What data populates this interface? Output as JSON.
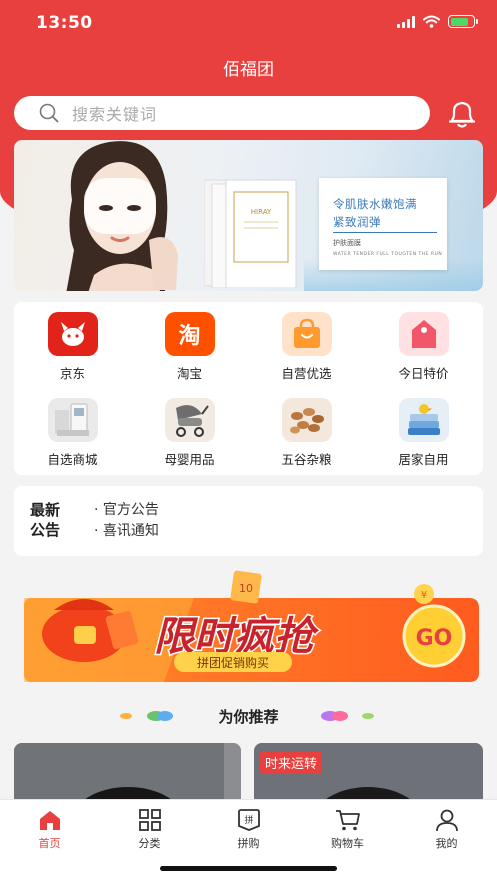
{
  "status_bar": {
    "time": "13:50"
  },
  "app": {
    "title": "佰福团"
  },
  "search": {
    "placeholder": "搜索关键词"
  },
  "banner": {
    "headline_1": "令肌肤水嫩饱满",
    "headline_2": "紧致润弹",
    "product": "护肤面膜",
    "tagline": "WATER  TENDER  FULL  TOUGTEN  THE  RUN",
    "pack_label": "HIRAY"
  },
  "categories": [
    {
      "label": "京东",
      "icon": "jd-icon"
    },
    {
      "label": "淘宝",
      "icon": "taobao-icon",
      "glyph": "淘"
    },
    {
      "label": "自营优选",
      "icon": "shopping-bag-icon"
    },
    {
      "label": "今日特价",
      "icon": "price-tag-icon"
    },
    {
      "label": "自选商城",
      "icon": "mall-icon"
    },
    {
      "label": "母婴用品",
      "icon": "stroller-icon"
    },
    {
      "label": "五谷杂粮",
      "icon": "grains-icon"
    },
    {
      "label": "居家自用",
      "icon": "towels-icon"
    }
  ],
  "notice": {
    "tag_line1": "最新",
    "tag_line2": "公告",
    "items": [
      "· 官方公告",
      "· 喜讯通知"
    ]
  },
  "promo": {
    "headline": "限时疯抢",
    "sub": "拼团促销购买",
    "go": "GO",
    "tag_number": "10",
    "coin_symbol": "¥"
  },
  "recommend": {
    "title": "为你推荐",
    "products": [
      {
        "badge": ""
      },
      {
        "badge": "时来运转"
      }
    ]
  },
  "tabbar": [
    {
      "label": "首页",
      "icon": "home-icon",
      "active": true
    },
    {
      "label": "分类",
      "icon": "grid-icon",
      "active": false
    },
    {
      "label": "拼购",
      "icon": "group-buy-icon",
      "glyph": "拼",
      "active": false
    },
    {
      "label": "购物车",
      "icon": "cart-icon",
      "active": false
    },
    {
      "label": "我的",
      "icon": "user-icon",
      "active": false
    }
  ],
  "colors": {
    "brand_red": "#e8403f",
    "background": "#f3f3f3",
    "banner_text": "#3b78b8"
  }
}
